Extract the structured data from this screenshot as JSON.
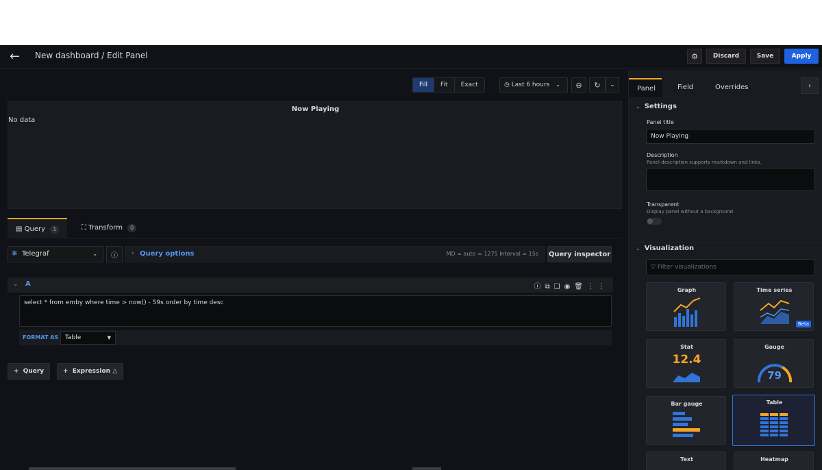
{
  "header": {
    "title": "New dashboard / Edit Panel",
    "discard_label": "Discard",
    "save_label": "Save",
    "apply_label": "Apply"
  },
  "viewbar": {
    "modes": [
      "Fill",
      "Fit",
      "Exact"
    ],
    "time_range": "Last 6 hours"
  },
  "preview": {
    "panel_title": "Now Playing",
    "no_data": "No data"
  },
  "query_tabs": {
    "query_label": "Query",
    "query_count": "1",
    "transform_label": "Transform",
    "transform_count": "0"
  },
  "datasource": {
    "name": "Telegraf",
    "query_options_label": "Query options",
    "meta": "MD = auto = 1275   Interval = 15s",
    "inspector_label": "Query inspector"
  },
  "query_a": {
    "ref": "A",
    "sql": "select * from emby where time > now() - 59s order by time desc",
    "format_label": "FORMAT AS",
    "format_value": "Table"
  },
  "add_buttons": {
    "query": "Query",
    "expression": "Expression"
  },
  "right_pane": {
    "tabs": [
      "Panel",
      "Field",
      "Overrides"
    ],
    "settings": {
      "heading": "Settings",
      "panel_title_label": "Panel title",
      "panel_title_value": "Now Playing",
      "description_label": "Description",
      "description_hint": "Panel description supports markdown and links.",
      "transparent_label": "Transparent",
      "transparent_hint": "Display panel without a background."
    },
    "visualization": {
      "heading": "Visualization",
      "filter_placeholder": "Filter visualizations",
      "cards": [
        {
          "name": "Graph"
        },
        {
          "name": "Time series",
          "badge": "Beta"
        },
        {
          "name": "Stat",
          "value": "12.4"
        },
        {
          "name": "Gauge",
          "value": "79"
        },
        {
          "name": "Bar gauge"
        },
        {
          "name": "Table"
        },
        {
          "name": "Text"
        },
        {
          "name": "Heatmap"
        }
      ]
    }
  },
  "colors": {
    "accent": "#1f62e0",
    "tab_active": "#f5a623",
    "link": "#5794f2",
    "viz_orange": "#f5a623",
    "viz_blue": "#3274d9"
  }
}
